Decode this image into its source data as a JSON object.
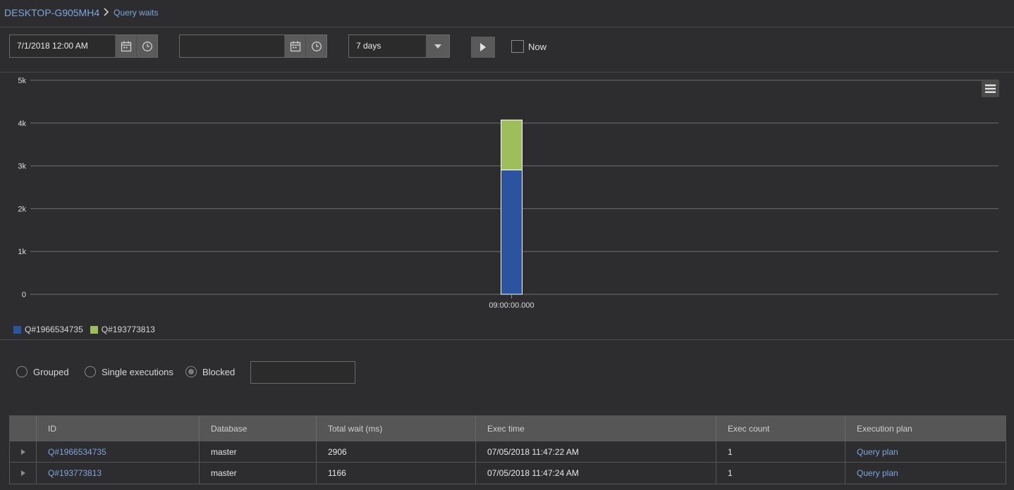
{
  "breadcrumb": {
    "server": "DESKTOP-G905MH4",
    "separator": ">",
    "page": "Query waits"
  },
  "toolbar": {
    "start_value": "7/1/2018 12:00 AM",
    "end_value": "",
    "range_value": "7 days",
    "now_label": "Now",
    "now_checked": false
  },
  "chart_data": {
    "type": "bar",
    "stacked": true,
    "categories": [
      "09:00:00.000"
    ],
    "series": [
      {
        "name": "Q#1966534735",
        "values": [
          2906
        ],
        "color": "#2b53a0"
      },
      {
        "name": "Q#193773813",
        "values": [
          1166
        ],
        "color": "#9dbe5a"
      }
    ],
    "ylim": [
      0,
      5000
    ],
    "yticks": [
      {
        "value": 0,
        "label": "0"
      },
      {
        "value": 1000,
        "label": "1k"
      },
      {
        "value": 2000,
        "label": "2k"
      },
      {
        "value": 3000,
        "label": "3k"
      },
      {
        "value": 4000,
        "label": "4k"
      },
      {
        "value": 5000,
        "label": "5k"
      }
    ],
    "grid": true,
    "legend_position": "bottom-left"
  },
  "modes": {
    "options": [
      "Grouped",
      "Single executions",
      "Blocked"
    ],
    "selected": "Blocked",
    "filter_value": ""
  },
  "table": {
    "columns": [
      "ID",
      "Database",
      "Total wait (ms)",
      "Exec time",
      "Exec count",
      "Execution plan"
    ],
    "rows": [
      {
        "id": "Q#1966534735",
        "database": "master",
        "total_wait": "2906",
        "exec_time": "07/05/2018 11:47:22 AM",
        "exec_count": "1",
        "plan": "Query plan"
      },
      {
        "id": "Q#193773813",
        "database": "master",
        "total_wait": "1166",
        "exec_time": "07/05/2018 11:47:24 AM",
        "exec_count": "1",
        "plan": "Query plan"
      }
    ]
  }
}
